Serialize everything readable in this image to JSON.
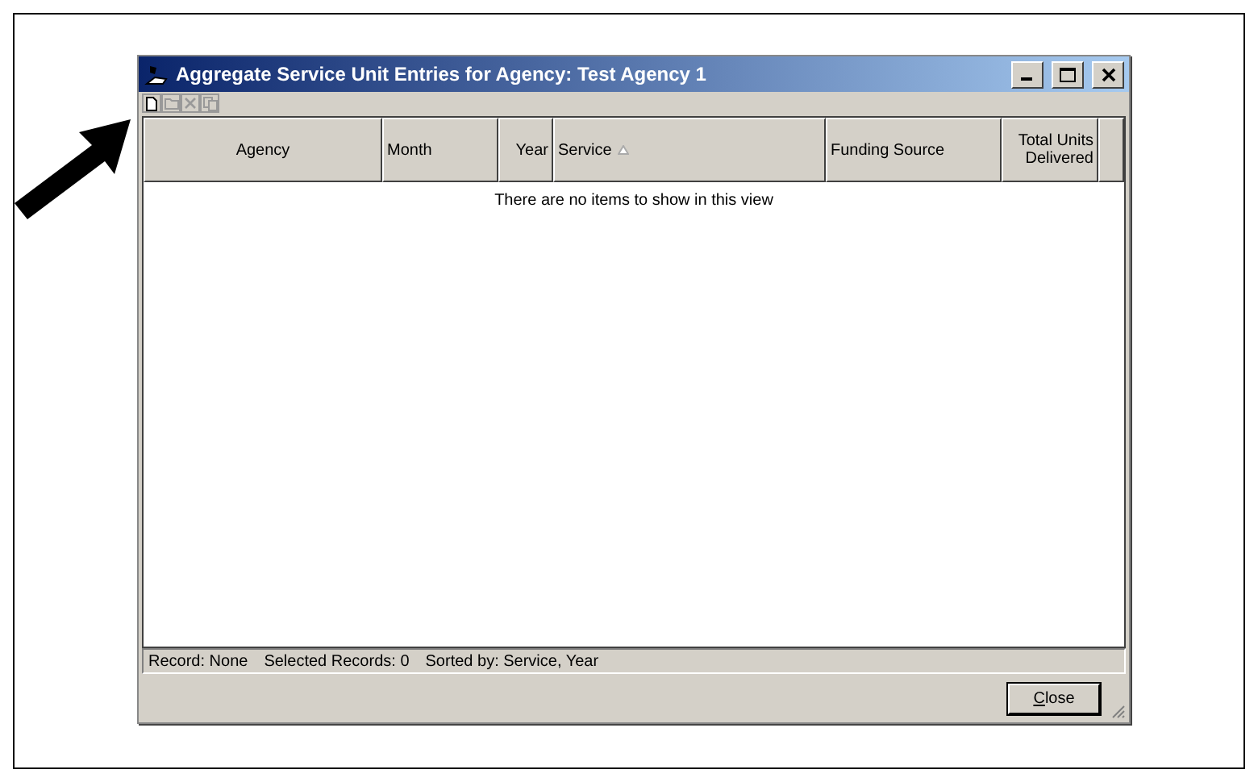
{
  "window": {
    "title": "Aggregate Service Unit Entries for Agency: Test Agency 1"
  },
  "toolbar": [
    {
      "kind": "new",
      "disabled": false
    },
    {
      "kind": "open",
      "disabled": true
    },
    {
      "kind": "delete",
      "disabled": true
    },
    {
      "kind": "copy",
      "disabled": true
    }
  ],
  "table": {
    "columns": [
      {
        "label": "Agency",
        "sorted": false
      },
      {
        "label": "Month",
        "sorted": false
      },
      {
        "label": "Year",
        "sorted": false
      },
      {
        "label": "Service",
        "sorted": true
      },
      {
        "label": "Funding Source",
        "sorted": false
      },
      {
        "label": "Total Units Delivered",
        "sorted": false
      }
    ],
    "empty_message": "There are no items to show in this view"
  },
  "status_bar": [
    "Record: None",
    "Selected Records: 0",
    "Sorted by: Service, Year"
  ],
  "buttons": [
    "Close"
  ]
}
